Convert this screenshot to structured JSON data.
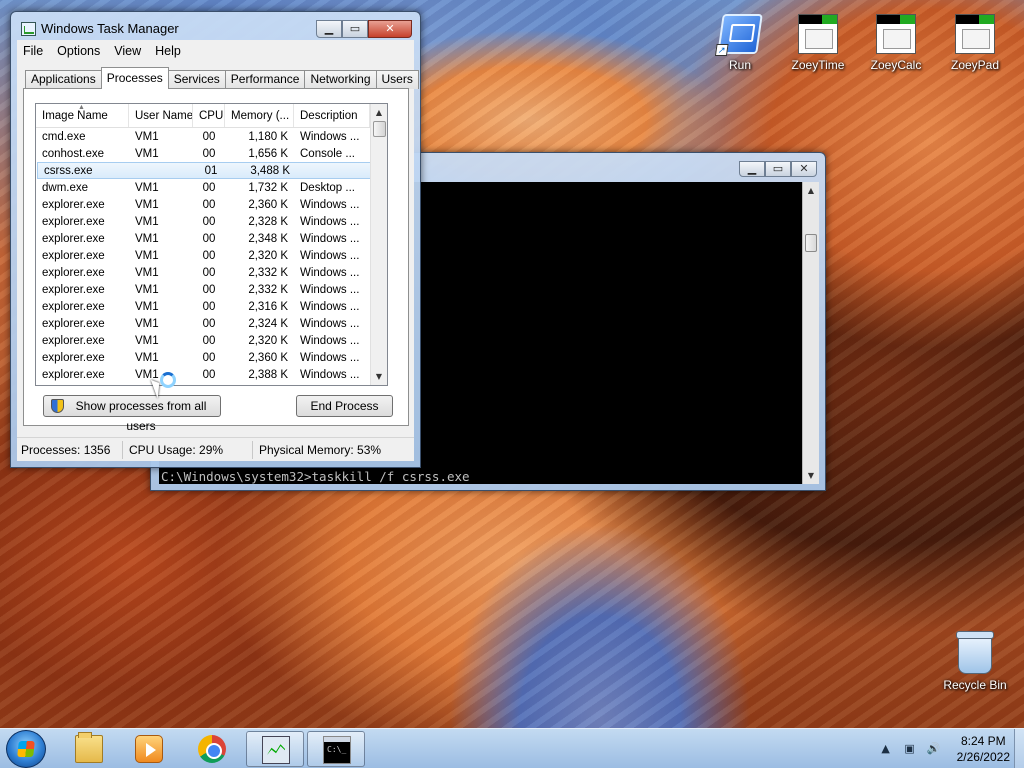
{
  "desktop": {
    "icons": [
      {
        "label": "Run"
      },
      {
        "label": "ZoeyTime"
      },
      {
        "label": "ZoeyCalc"
      },
      {
        "label": "ZoeyPad"
      },
      {
        "label": "Recycle Bin"
      }
    ]
  },
  "console": {
    "line": "C:\\Windows\\system32>taskkill /f csrss.exe"
  },
  "taskmgr": {
    "title": "Windows Task Manager",
    "menu": [
      "File",
      "Options",
      "View",
      "Help"
    ],
    "tabs": [
      "Applications",
      "Processes",
      "Services",
      "Performance",
      "Networking",
      "Users"
    ],
    "active_tab": "Processes",
    "columns": [
      "Image Name",
      "User Name",
      "CPU",
      "Memory (...",
      "Description"
    ],
    "processes": [
      {
        "name": "cmd.exe",
        "user": "VM1",
        "cpu": "00",
        "mem": "1,180 K",
        "desc": "Windows ..."
      },
      {
        "name": "conhost.exe",
        "user": "VM1",
        "cpu": "00",
        "mem": "1,656 K",
        "desc": "Console ..."
      },
      {
        "name": "csrss.exe",
        "user": "",
        "cpu": "01",
        "mem": "3,488 K",
        "desc": ""
      },
      {
        "name": "dwm.exe",
        "user": "VM1",
        "cpu": "00",
        "mem": "1,732 K",
        "desc": "Desktop ..."
      },
      {
        "name": "explorer.exe",
        "user": "VM1",
        "cpu": "00",
        "mem": "2,360 K",
        "desc": "Windows ..."
      },
      {
        "name": "explorer.exe",
        "user": "VM1",
        "cpu": "00",
        "mem": "2,328 K",
        "desc": "Windows ..."
      },
      {
        "name": "explorer.exe",
        "user": "VM1",
        "cpu": "00",
        "mem": "2,348 K",
        "desc": "Windows ..."
      },
      {
        "name": "explorer.exe",
        "user": "VM1",
        "cpu": "00",
        "mem": "2,320 K",
        "desc": "Windows ..."
      },
      {
        "name": "explorer.exe",
        "user": "VM1",
        "cpu": "00",
        "mem": "2,332 K",
        "desc": "Windows ..."
      },
      {
        "name": "explorer.exe",
        "user": "VM1",
        "cpu": "00",
        "mem": "2,332 K",
        "desc": "Windows ..."
      },
      {
        "name": "explorer.exe",
        "user": "VM1",
        "cpu": "00",
        "mem": "2,316 K",
        "desc": "Windows ..."
      },
      {
        "name": "explorer.exe",
        "user": "VM1",
        "cpu": "00",
        "mem": "2,324 K",
        "desc": "Windows ..."
      },
      {
        "name": "explorer.exe",
        "user": "VM1",
        "cpu": "00",
        "mem": "2,320 K",
        "desc": "Windows ..."
      },
      {
        "name": "explorer.exe",
        "user": "VM1",
        "cpu": "00",
        "mem": "2,360 K",
        "desc": "Windows ..."
      },
      {
        "name": "explorer.exe",
        "user": "VM1",
        "cpu": "00",
        "mem": "2,388 K",
        "desc": "Windows ..."
      }
    ],
    "selected_index": 2,
    "show_all_label": "Show processes from all users",
    "end_process_label": "End Process",
    "status": {
      "processes": "Processes: 1356",
      "cpu": "CPU Usage: 29%",
      "memory": "Physical Memory: 53%"
    }
  },
  "taskbar": {
    "apps": [
      "file-explorer",
      "media-player",
      "chrome",
      "task-manager",
      "command-prompt"
    ],
    "active_apps": [
      "task-manager",
      "command-prompt"
    ],
    "clock_time": "8:24 PM",
    "clock_date": "2/26/2022"
  }
}
